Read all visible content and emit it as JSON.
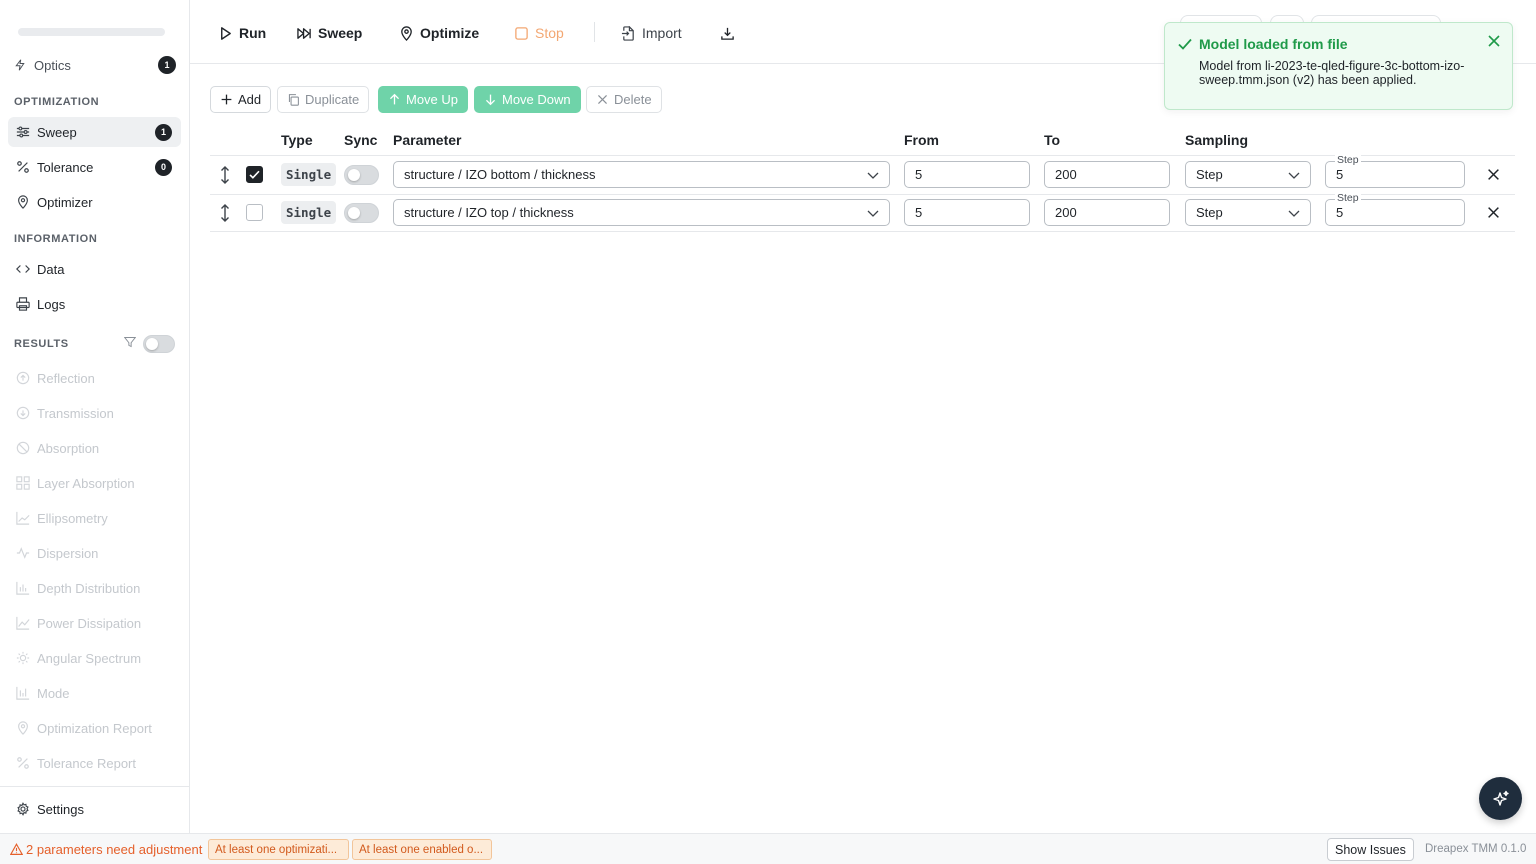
{
  "sidebar": {
    "cut_item": {
      "label": "Optics",
      "count": "1"
    },
    "optimization_title": "OPTIMIZATION",
    "optimization_items": [
      {
        "label": "Sweep",
        "count": "1",
        "icon": "sliders-icon"
      },
      {
        "label": "Tolerance",
        "count": "0",
        "icon": "percent-icon"
      },
      {
        "label": "Optimizer",
        "icon": "pin-icon"
      }
    ],
    "information_title": "INFORMATION",
    "information_items": [
      {
        "label": "Data",
        "icon": "code-icon"
      },
      {
        "label": "Logs",
        "icon": "printer-icon"
      }
    ],
    "results_title": "RESULTS",
    "results_items": [
      {
        "label": "Reflection"
      },
      {
        "label": "Transmission"
      },
      {
        "label": "Absorption"
      },
      {
        "label": "Layer Absorption"
      },
      {
        "label": "Ellipsometry"
      },
      {
        "label": "Dispersion"
      },
      {
        "label": "Depth Distribution"
      },
      {
        "label": "Power Dissipation"
      },
      {
        "label": "Angular Spectrum"
      },
      {
        "label": "Mode"
      },
      {
        "label": "Optimization Report"
      },
      {
        "label": "Tolerance Report"
      }
    ],
    "settings_label": "Settings"
  },
  "toolbar": {
    "run": "Run",
    "sweep": "Sweep",
    "optimize": "Optimize",
    "stop": "Stop",
    "import": "Import"
  },
  "toast": {
    "title": "Model loaded from file",
    "body": "Model from li-2023-te-qled-figure-3c-bottom-izo-sweep.tmm.json (v2) has been applied."
  },
  "actions": {
    "add": "Add",
    "duplicate": "Duplicate",
    "move_up": "Move Up",
    "move_down": "Move Down",
    "delete": "Delete"
  },
  "table": {
    "headers": {
      "type": "Type",
      "sync": "Sync",
      "parameter": "Parameter",
      "from": "From",
      "to": "To",
      "sampling": "Sampling"
    },
    "rows": [
      {
        "checked": true,
        "type": "Single",
        "parameter": "structure / IZO bottom / thickness",
        "from": "5",
        "to": "200",
        "sampling": "Step",
        "step_label": "Step",
        "step": "5"
      },
      {
        "checked": false,
        "type": "Single",
        "parameter": "structure / IZO top / thickness",
        "from": "5",
        "to": "200",
        "sampling": "Step",
        "step_label": "Step",
        "step": "5"
      }
    ]
  },
  "status": {
    "warning": "2 parameters need adjustment",
    "chip1": "At least one optimizati...",
    "chip2": "At least one enabled o...",
    "show_issues": "Show Issues",
    "version": "Dreapex TMM 0.1.0"
  },
  "colors": {
    "accent_green": "#6fd3a9",
    "success": "#1f9a49",
    "warning": "#e5602b",
    "stop": "#f3a772"
  }
}
